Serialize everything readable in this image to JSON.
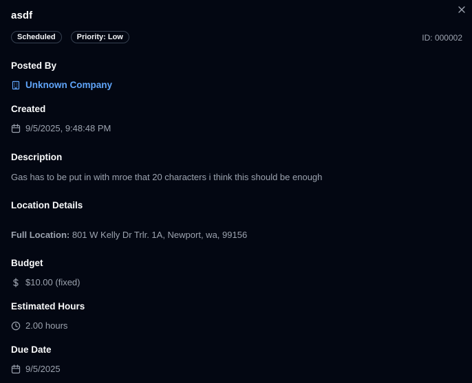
{
  "job": {
    "title": "asdf",
    "id_text": "ID: 000002",
    "badges": [
      "Scheduled",
      "Priority: Low"
    ]
  },
  "posted_by": {
    "label": "Posted By",
    "company": "Unknown Company"
  },
  "created": {
    "label": "Created",
    "value": "9/5/2025, 9:48:48 PM"
  },
  "description": {
    "label": "Description",
    "text": "Gas has to be put in with mroe that 20 characters i think this should be enough"
  },
  "location": {
    "label": "Location Details",
    "full_label": "Full Location:",
    "full_value": "801 W Kelly Dr Trlr. 1A, Newport, wa, 99156"
  },
  "budget": {
    "label": "Budget",
    "value": "$10.00 (fixed)"
  },
  "hours": {
    "label": "Estimated Hours",
    "value": "2.00 hours"
  },
  "due": {
    "label": "Due Date",
    "value": "9/5/2025"
  },
  "icons": {
    "close": "close-icon",
    "company": "building-icon",
    "created": "calendar-icon",
    "budget": "dollar-icon",
    "hours": "clock-icon",
    "due": "calendar-icon"
  },
  "colors": {
    "background": "#030712",
    "link": "#60a5fa",
    "muted": "#9ca3af",
    "badge_border": "#374151"
  }
}
